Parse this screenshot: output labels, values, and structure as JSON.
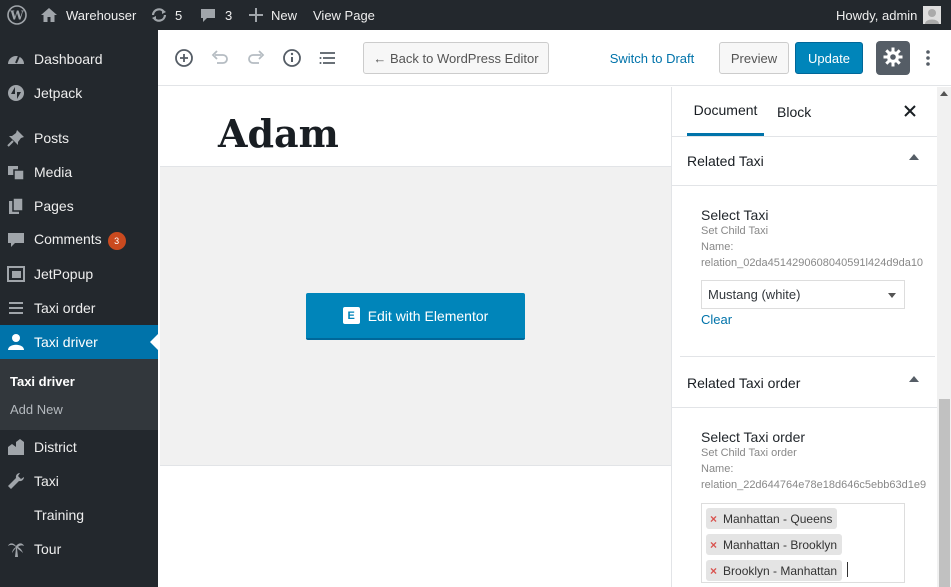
{
  "adminbar": {
    "site_name": "Warehouser",
    "updates_count": "5",
    "comments_count": "3",
    "new_label": "New",
    "view_page_label": "View Page",
    "greeting": "Howdy, admin"
  },
  "sidebar": {
    "items": [
      {
        "label": "Dashboard",
        "icon": "dashboard-icon"
      },
      {
        "label": "Jetpack",
        "icon": "jetpack-icon"
      },
      {
        "label": "Posts",
        "icon": "pin-icon"
      },
      {
        "label": "Media",
        "icon": "media-icon"
      },
      {
        "label": "Pages",
        "icon": "pages-icon"
      },
      {
        "label": "Comments",
        "icon": "comments-icon",
        "badge": "3"
      },
      {
        "label": "JetPopup",
        "icon": "popup-icon"
      },
      {
        "label": "Taxi order",
        "icon": "list-icon"
      },
      {
        "label": "Taxi driver",
        "icon": "user-icon"
      },
      {
        "label": "District",
        "icon": "building-icon"
      },
      {
        "label": "Taxi",
        "icon": "wrench-icon"
      },
      {
        "label": "Training",
        "icon": ""
      },
      {
        "label": "Tour",
        "icon": "palm-icon"
      }
    ],
    "submenu": {
      "current": "Taxi driver",
      "add_new": "Add New"
    },
    "active_color": "#0073aa"
  },
  "toolbar": {
    "back_label": "← Back to WordPress Editor",
    "switch_draft_label": "Switch to Draft",
    "preview_label": "Preview",
    "update_label": "Update"
  },
  "post": {
    "title": "Adam",
    "elementor_button": "Edit with Elementor",
    "elementor_logo": "E"
  },
  "panel": {
    "tabs": {
      "document": "Document",
      "block": "Block"
    },
    "related_taxi": {
      "header": "Related Taxi",
      "field_title": "Select Taxi",
      "desc_line1": "Set Child Taxi",
      "desc_line2": "Name:",
      "desc_line3": "relation_02da4514290608040591l424d9da10",
      "selected": "Mustang (white)",
      "clear_label": "Clear"
    },
    "related_taxi_order": {
      "header": "Related Taxi order",
      "field_title": "Select Taxi order",
      "desc_line1": "Set Child Taxi order",
      "desc_line2": "Name:",
      "desc_line3": "relation_22d644764e78e18d646c5ebb63d1e9",
      "chips": [
        "Manhattan - Queens",
        "Manhattan - Brooklyn",
        "Brooklyn - Manhattan"
      ],
      "chip_remove": "×"
    }
  },
  "colors": {
    "accent": "#0073aa",
    "button": "#0085ba",
    "adminbar": "#23282d",
    "badge": "#ca4a1f"
  }
}
